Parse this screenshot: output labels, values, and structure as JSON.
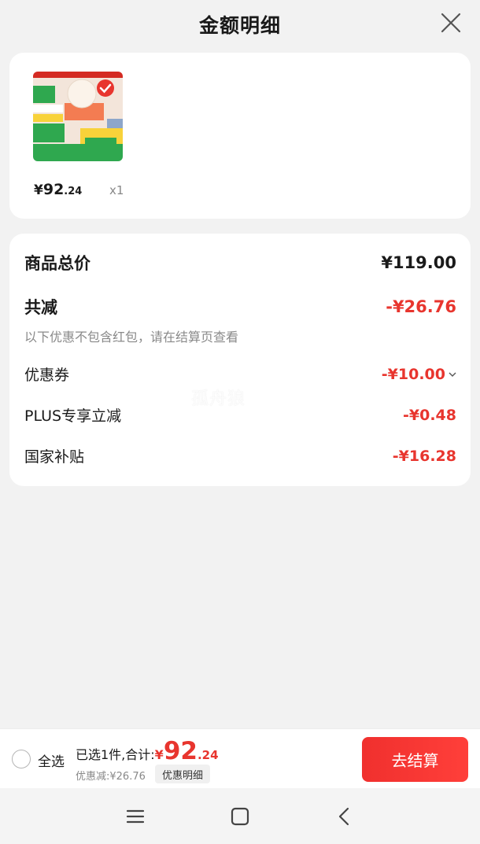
{
  "header": {
    "title": "金额明细"
  },
  "product": {
    "price_currency": "¥",
    "price_int": "92",
    "price_dec": ".24",
    "quantity": "x1",
    "selected": true
  },
  "details": {
    "total_label": "商品总价",
    "total_value": "¥119.00",
    "discount_label": "共减",
    "discount_value": "-¥26.76",
    "note": "以下优惠不包含红包，请在结算页查看",
    "items": [
      {
        "label": "优惠券",
        "value": "-¥10.00"
      },
      {
        "label": "PLUS专享立减",
        "value": "-¥0.48"
      },
      {
        "label": "国家补贴",
        "value": "-¥16.28"
      }
    ],
    "watermark": "孤舟狼"
  },
  "bottom_bar": {
    "select_all": "全选",
    "summary_text": "已选1件,合计:",
    "total_currency": "¥",
    "total_int": "92",
    "total_dec": ".24",
    "discount_text": "优惠减:¥26.76",
    "detail_chip": "优惠明细",
    "checkout": "去结算"
  },
  "colors": {
    "accent_red": "#e8352e",
    "background": "#f2f2f2"
  }
}
